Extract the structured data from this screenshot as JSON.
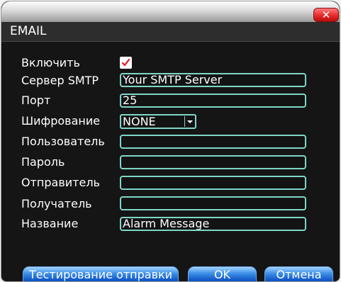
{
  "dialog": {
    "heading": "EMAIL",
    "close_icon": "close-x-icon"
  },
  "form": {
    "enable": {
      "label": "Включить",
      "checked": true
    },
    "smtp_server": {
      "label": "Сервер SMTP",
      "value": "Your SMTP Server"
    },
    "port": {
      "label": "Порт",
      "value": "25"
    },
    "encryption": {
      "label": "Шифрование",
      "value": "NONE"
    },
    "user": {
      "label": "Пользователь",
      "value": ""
    },
    "password": {
      "label": "Пароль",
      "value": ""
    },
    "sender": {
      "label": "Отправитель",
      "value": ""
    },
    "recipient": {
      "label": "Получатель",
      "value": ""
    },
    "subject": {
      "label": "Название",
      "value": "Alarm Message"
    }
  },
  "buttons": {
    "test_send": "Тестирование отправки",
    "ok": "OK",
    "cancel": "Отмена"
  },
  "colors": {
    "background": "#151515",
    "field_border": "#7fd6c6",
    "button_blue": "#3d8fe6",
    "close_red": "#e62b2b"
  }
}
